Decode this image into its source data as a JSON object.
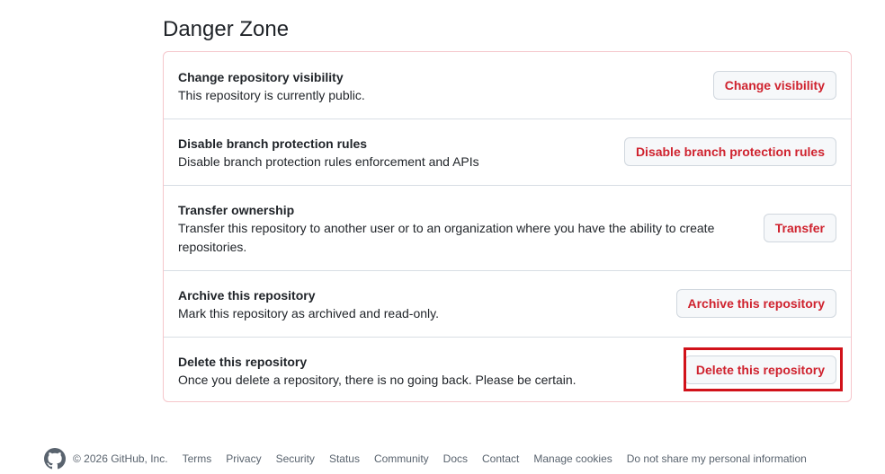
{
  "danger_zone": {
    "title": "Danger Zone",
    "rows": [
      {
        "title": "Change repository visibility",
        "description": "This repository is currently public.",
        "button_label": "Change visibility"
      },
      {
        "title": "Disable branch protection rules",
        "description": "Disable branch protection rules enforcement and APIs",
        "button_label": "Disable branch protection rules"
      },
      {
        "title": "Transfer ownership",
        "description_line1": "Transfer this repository to another user or to an organization where you have the ability to create",
        "description_line2": "repositories.",
        "button_label": "Transfer"
      },
      {
        "title": "Archive this repository",
        "description": "Mark this repository as archived and read-only.",
        "button_label": "Archive this repository"
      },
      {
        "title": "Delete this repository",
        "description": "Once you delete a repository, there is no going back. Please be certain.",
        "button_label": "Delete this repository"
      }
    ]
  },
  "colors": {
    "danger_text": "#cf222e",
    "danger_border": "#f5c6cb",
    "highlight": "#d1121a"
  },
  "footer": {
    "logo_icon": "github-mark-icon",
    "copyright": "© 2026 GitHub, Inc.",
    "links": [
      "Terms",
      "Privacy",
      "Security",
      "Status",
      "Community",
      "Docs",
      "Contact",
      "Manage cookies",
      "Do not share my personal information"
    ]
  }
}
